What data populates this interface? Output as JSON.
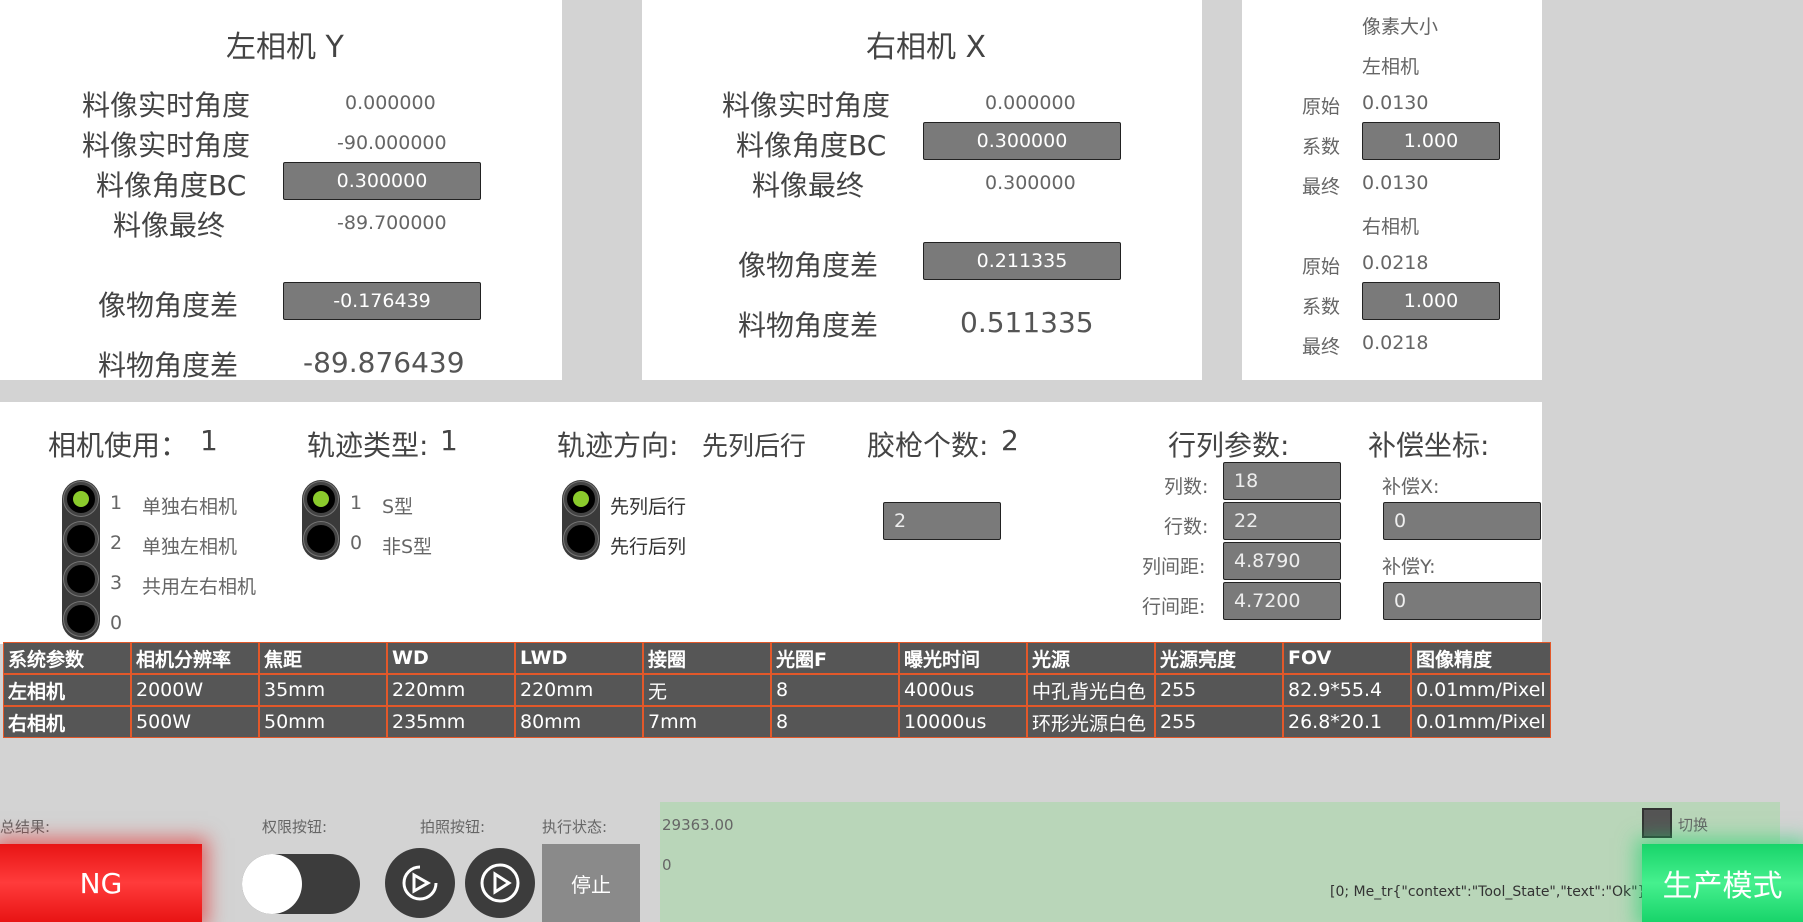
{
  "left_cam": {
    "title": "左相机 Y",
    "rows": [
      {
        "label": "料像实时角度",
        "value": "0.000000"
      },
      {
        "label": "料像实时角度",
        "value": "-90.000000"
      },
      {
        "label": "料像角度BC",
        "value": "0.300000"
      },
      {
        "label": "料像最终",
        "value": "-89.700000"
      }
    ],
    "diff_label": "像物角度差",
    "diff_value": "-0.176439",
    "final_label": "料物角度差",
    "final_value": "-89.876439"
  },
  "right_cam": {
    "title": "右相机 X",
    "rows": [
      {
        "label": "料像实时角度",
        "value": "0.000000"
      },
      {
        "label": "料像角度BC",
        "value": "0.300000"
      },
      {
        "label": "料像最终",
        "value": "0.300000"
      }
    ],
    "diff_label": "像物角度差",
    "diff_value": "0.211335",
    "final_label": "料物角度差",
    "final_value": "0.511335"
  },
  "pixel": {
    "title": "像素大小",
    "left_title": "左相机",
    "right_title": "右相机",
    "raw_label": "原始",
    "coef_label": "系数",
    "final_label": "最终",
    "left": {
      "raw": "0.0130",
      "coef": "1.000",
      "final": "0.0130"
    },
    "right": {
      "raw": "0.0218",
      "coef": "1.000",
      "final": "0.0218"
    }
  },
  "settings": {
    "camera_use_label": "相机使用：",
    "camera_use_value": "1",
    "camera_options": [
      {
        "num": "1",
        "text": "单独右相机"
      },
      {
        "num": "2",
        "text": "单独左相机"
      },
      {
        "num": "3",
        "text": "共用左右相机"
      },
      {
        "num": "0",
        "text": ""
      }
    ],
    "track_type_label": "轨迹类型:",
    "track_type_value": "1",
    "track_options": [
      {
        "num": "1",
        "text": "S型"
      },
      {
        "num": "0",
        "text": "非S型"
      }
    ],
    "track_dir_label": "轨迹方向:",
    "track_dir_value": "先列后行",
    "dir_options": [
      "先列后行",
      "先行后列"
    ],
    "gun_label": "胶枪个数:",
    "gun_value": "2",
    "gun_input": "2",
    "rowcol_title": "行列参数:",
    "cols_label": "列数:",
    "cols_value": "18",
    "rows_label": "行数:",
    "rows_value": "22",
    "col_gap_label": "列间距:",
    "col_gap_value": "4.8790",
    "row_gap_label": "行间距:",
    "row_gap_value": "4.7200",
    "comp_title": "补偿坐标:",
    "comp_x_label": "补偿X:",
    "comp_x_value": "0",
    "comp_y_label": "补偿Y:",
    "comp_y_value": "0"
  },
  "table": {
    "header": [
      "系统参数",
      "相机分辨率",
      "焦距",
      "WD",
      "LWD",
      "接圈",
      "光圈F",
      "曝光时间",
      "光源",
      "光源亮度",
      "FOV",
      "图像精度"
    ],
    "rows": [
      [
        "左相机",
        "2000W",
        "35mm",
        "220mm",
        "220mm",
        "无",
        "8",
        "4000us",
        "中孔背光白色",
        "255",
        "82.9*55.4",
        "0.01mm/Pixel"
      ],
      [
        "右相机",
        "500W",
        "50mm",
        "235mm",
        "80mm",
        "7mm",
        "8",
        "10000us",
        "环形光源白色",
        "255",
        "26.8*20.1",
        "0.01mm/Pixel"
      ]
    ]
  },
  "bottom": {
    "result_label": "总结果:",
    "result_value": "NG",
    "perm_label": "权限按钮:",
    "photo_label": "拍照按钮:",
    "exec_label": "执行状态:",
    "stop_label": "停止",
    "log_value1": "29363.00",
    "log_value2": "0",
    "log_msg": "[0; Me_tr{\"context\":\"Tool_State\",\"text\":\"Ok\"}]",
    "switch_label": "切换",
    "mode_label": "生产模式"
  },
  "colors": {
    "ng_red": "#e81414",
    "mode_green": "#18d46a",
    "log_bg": "#b9d6b9",
    "radio_on": "#8acb2c",
    "table_border": "#e2582a"
  }
}
